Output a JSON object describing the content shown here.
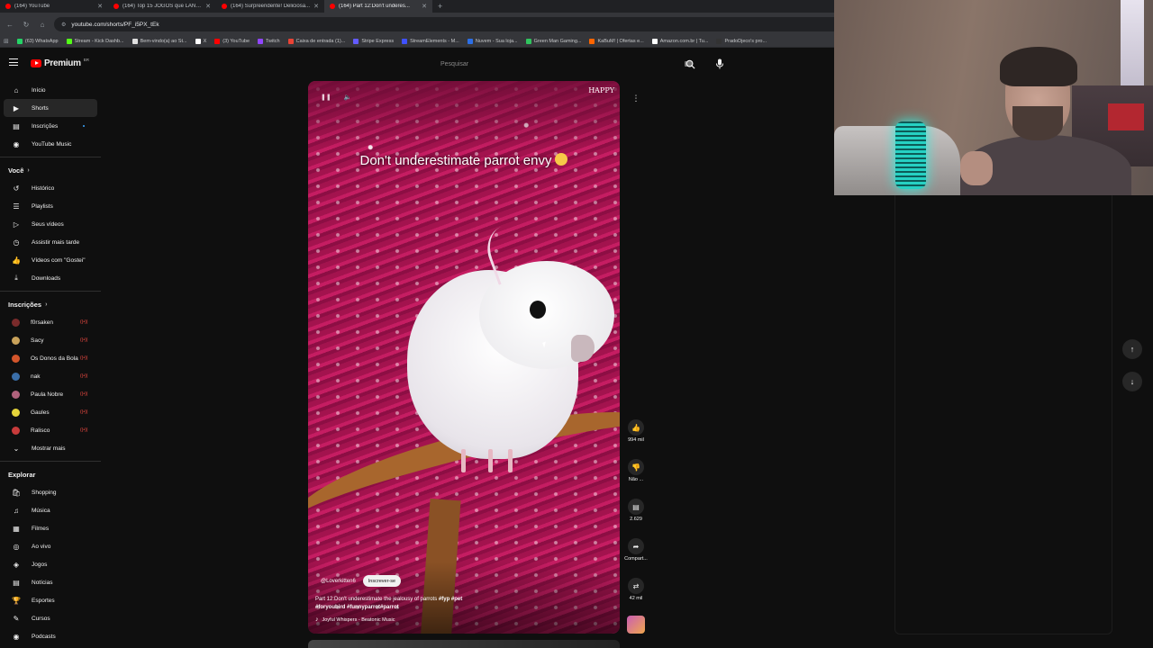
{
  "browser": {
    "tabs": [
      {
        "title": "(164) YouTube",
        "active": false
      },
      {
        "title": "(164) Top 15 JOGOS que LANÇ...",
        "active": false
      },
      {
        "title": "(164) Surpreendente! Deliciosa...",
        "active": false
      },
      {
        "title": "(164) Part 12:Don't underes...",
        "active": true
      }
    ],
    "url": "youtube.com/shorts/PF_i5PX_tEk",
    "bookmarks": [
      {
        "label": "(63) WhatsApp",
        "color": "#25d366"
      },
      {
        "label": "Stream - Kick Dashb...",
        "color": "#53fc18"
      },
      {
        "label": "Bem-vindo(a) ao St...",
        "color": "#e0e0e0"
      },
      {
        "label": "X",
        "color": "#ffffff"
      },
      {
        "label": "(3) YouTube",
        "color": "#ff0000"
      },
      {
        "label": "Twitch",
        "color": "#9146ff"
      },
      {
        "label": "Caixa de entrada (1)...",
        "color": "#ea4335"
      },
      {
        "label": "Stripe Express",
        "color": "#635bff"
      },
      {
        "label": "StreamElements - M...",
        "color": "#3f51ff"
      },
      {
        "label": "Nuvem - Sua loja...",
        "color": "#2c6fe6"
      },
      {
        "label": "Green Man Gaming...",
        "color": "#30c45e"
      },
      {
        "label": "KaBuM! | Ofertas e...",
        "color": "#ff6500"
      },
      {
        "label": "Amazon.com.br | Tu...",
        "color": "#ffffff"
      },
      {
        "label": "PradoDjeco's pro...",
        "color": "#333333"
      }
    ]
  },
  "header": {
    "brand": "Premium",
    "region": "BR",
    "search_placeholder": "Pesquisar"
  },
  "sidebar": {
    "main": [
      {
        "label": "Início",
        "icon": "home-icon",
        "glyph": "⌂",
        "active": false
      },
      {
        "label": "Shorts",
        "icon": "shorts-icon",
        "glyph": "▶",
        "active": true
      },
      {
        "label": "Inscrições",
        "icon": "subscriptions-icon",
        "glyph": "▤",
        "active": false,
        "dot": true
      },
      {
        "label": "YouTube Music",
        "icon": "youtube-music-icon",
        "glyph": "◉",
        "active": false
      }
    ],
    "you_title": "Você",
    "you": [
      {
        "label": "Histórico",
        "icon": "history-icon",
        "glyph": "↺"
      },
      {
        "label": "Playlists",
        "icon": "playlists-icon",
        "glyph": "☰"
      },
      {
        "label": "Seus vídeos",
        "icon": "your-videos-icon",
        "glyph": "▷"
      },
      {
        "label": "Assistir mais tarde",
        "icon": "watch-later-icon",
        "glyph": "◷"
      },
      {
        "label": "Vídeos com \"Gostei\"",
        "icon": "liked-videos-icon",
        "glyph": "👍"
      },
      {
        "label": "Downloads",
        "icon": "downloads-icon",
        "glyph": "⤓"
      }
    ],
    "subs_title": "Inscrições",
    "subs": [
      {
        "label": "f0rsaken",
        "color": "#7a2b2b"
      },
      {
        "label": "Sacy",
        "color": "#c9a25a"
      },
      {
        "label": "Os Donos da Bola",
        "color": "#d3552b"
      },
      {
        "label": "nak",
        "color": "#3a6ea8"
      },
      {
        "label": "Paula Nobre",
        "color": "#b0627c"
      },
      {
        "label": "Gaules",
        "color": "#e5d43a"
      },
      {
        "label": "Ralisco",
        "color": "#c83b3b"
      }
    ],
    "show_more": "Mostrar mais",
    "explore_title": "Explorar",
    "explore": [
      {
        "label": "Shopping",
        "icon": "shopping-icon",
        "glyph": "🛍"
      },
      {
        "label": "Música",
        "icon": "music-icon",
        "glyph": "♫"
      },
      {
        "label": "Filmes",
        "icon": "movies-icon",
        "glyph": "▦"
      },
      {
        "label": "Ao vivo",
        "icon": "live-icon",
        "glyph": "◎"
      },
      {
        "label": "Jogos",
        "icon": "gaming-icon",
        "glyph": "◈"
      },
      {
        "label": "Notícias",
        "icon": "news-icon",
        "glyph": "▤"
      },
      {
        "label": "Esportes",
        "icon": "sports-icon",
        "glyph": "🏆"
      },
      {
        "label": "Cursos",
        "icon": "courses-icon",
        "glyph": "✎"
      },
      {
        "label": "Podcasts",
        "icon": "podcasts-icon",
        "glyph": "◉"
      }
    ]
  },
  "video": {
    "watermark": "HAPPY",
    "caption": "Don't underestimate parrot envy",
    "channel_handle": "@Loverkitten6",
    "subscribe_label": "Inscrever-se",
    "description_plain": "Part 12:Don't underestimate the jealousy of parrots",
    "description_tags": "#fyp #pet",
    "description_tags2": "#foryoubird #funnyparrot#parrot",
    "music": "Joyful Whispers - Beatonic Music"
  },
  "actions": {
    "like_count": "994 mil",
    "dislike_label": "Não ...",
    "comments_count": "2.629",
    "share_label": "Compart...",
    "remix_count": "42 mil"
  }
}
